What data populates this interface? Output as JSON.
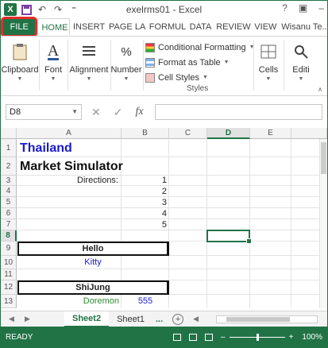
{
  "window": {
    "title": "exelrms01 - Excel"
  },
  "tabs": [
    "FILE",
    "HOME",
    "INSERT",
    "PAGE LA",
    "FORMUL",
    "DATA",
    "REVIEW",
    "VIEW",
    "Wisanu Te..."
  ],
  "ribbon": {
    "clipboard": "Clipboard",
    "font": "Font",
    "alignment": "Alignment",
    "number": "Number",
    "conditional_formatting": "Conditional Formatting",
    "format_as_table": "Format as Table",
    "cell_styles": "Cell Styles",
    "styles_group": "Styles",
    "cells": "Cells",
    "editing": "Editi",
    "font_icon": "A",
    "number_icon": "%"
  },
  "formula_bar": {
    "name_box": "D8",
    "fx": "fx",
    "value": ""
  },
  "columns": [
    "A",
    "B",
    "C",
    "D",
    "E"
  ],
  "selected_column": "D",
  "rows": [
    "1",
    "2",
    "3",
    "4",
    "5",
    "6",
    "7",
    "8",
    "9",
    "10",
    "11",
    "12",
    "13"
  ],
  "selected_row": "8",
  "cells": {
    "a1": "Thailand",
    "a2": "Market Simulator",
    "a3": "Directions:",
    "b3": "1",
    "b4": "2",
    "b5": "3",
    "b6": "4",
    "b7": "5",
    "a9": "Hello",
    "a10": "Kitty",
    "a12": "ShiJung",
    "a13": "Doremon",
    "b13": "555"
  },
  "sheets": [
    "Sheet2",
    "Sheet1",
    "..."
  ],
  "status": {
    "ready": "READY",
    "zoom": "100%"
  },
  "colors": {
    "accent": "#217346",
    "highlight": "#e52b2b",
    "blue_text": "#1a1acc",
    "green_text": "#2e8b2e"
  }
}
